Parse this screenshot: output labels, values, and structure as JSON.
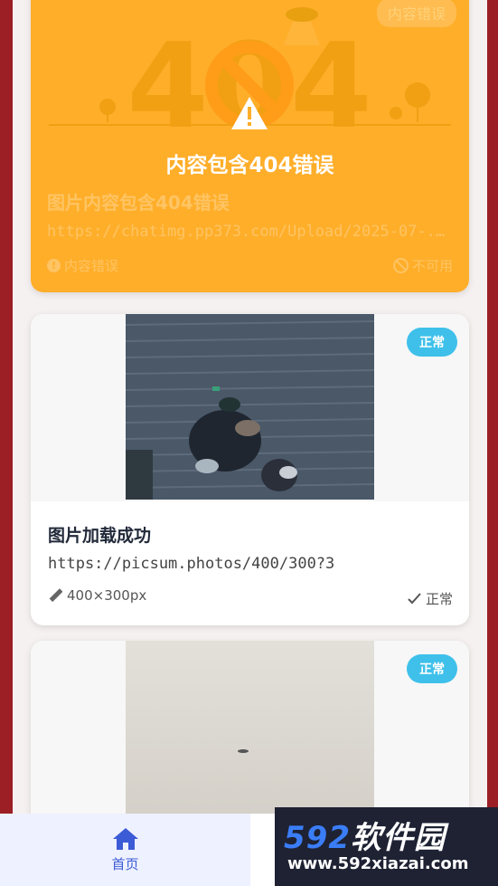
{
  "error_card": {
    "art_text": "404",
    "title": "内容包含404错误",
    "badge": "内容错误",
    "name": "图片内容包含404错误",
    "url": "https://chatimg.pp373.com/Upload/2025-07-...",
    "meta_left": "内容错误",
    "meta_right": "不可用"
  },
  "cards": [
    {
      "badge": "正常",
      "name": "图片加载成功",
      "url": "https://picsum.photos/400/300?3",
      "size": "400×300px",
      "status": "正常"
    },
    {
      "badge": "正常"
    }
  ],
  "nav": {
    "home_label": "首页"
  },
  "watermark": {
    "brand_num": "592",
    "brand_text": "软件园",
    "site": "www.592xiazai.com"
  },
  "colors": {
    "error_bg": "#ffae2a",
    "badge_ok": "#3ec0ea",
    "nav_active": "#3c5bd6"
  }
}
